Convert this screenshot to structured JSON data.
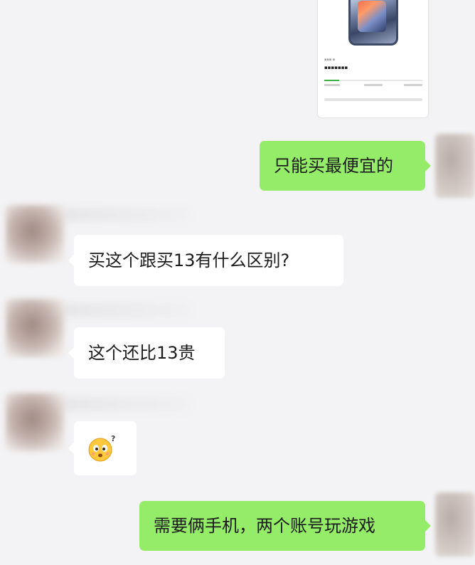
{
  "messages": [
    {
      "side": "right",
      "type": "text",
      "text": "只能买最便宜的"
    },
    {
      "side": "left",
      "type": "text",
      "text": "买这个跟买13有什么区别?"
    },
    {
      "side": "left",
      "type": "text",
      "text": "这个还比13贵"
    },
    {
      "side": "left",
      "type": "sticker",
      "sticker": "confused-face-emoji"
    },
    {
      "side": "right",
      "type": "text",
      "text": "需要俩手机，两个账号玩游戏"
    }
  ],
  "shared_card": {
    "image": "iphone-product-image",
    "progress_percent": 15
  },
  "colors": {
    "background": "#f3f3f5",
    "outgoing_bubble": "#95ec69",
    "incoming_bubble": "#ffffff",
    "progress": "#3cb043"
  }
}
